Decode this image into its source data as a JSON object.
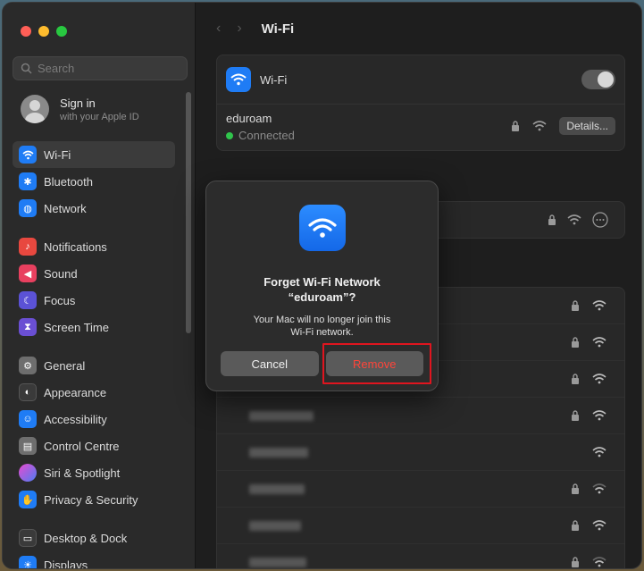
{
  "window": {
    "title": "Wi-Fi"
  },
  "sidebar": {
    "search_placeholder": "Search",
    "account": {
      "title": "Sign in",
      "subtitle": "with your Apple ID"
    },
    "items": [
      {
        "label": "Wi-Fi",
        "icon": "wifi-icon",
        "active": true
      },
      {
        "label": "Bluetooth",
        "icon": "bluetooth-icon"
      },
      {
        "label": "Network",
        "icon": "globe-icon"
      },
      {
        "label": "Notifications",
        "icon": "bell-icon"
      },
      {
        "label": "Sound",
        "icon": "speaker-icon"
      },
      {
        "label": "Focus",
        "icon": "moon-icon"
      },
      {
        "label": "Screen Time",
        "icon": "hourglass-icon"
      },
      {
        "label": "General",
        "icon": "gear-icon"
      },
      {
        "label": "Appearance",
        "icon": "appearance-icon"
      },
      {
        "label": "Accessibility",
        "icon": "accessibility-icon"
      },
      {
        "label": "Control Centre",
        "icon": "control-centre-icon"
      },
      {
        "label": "Siri & Spotlight",
        "icon": "siri-icon"
      },
      {
        "label": "Privacy & Security",
        "icon": "hand-icon"
      },
      {
        "label": "Desktop & Dock",
        "icon": "dock-icon"
      },
      {
        "label": "Displays",
        "icon": "display-icon"
      }
    ]
  },
  "main": {
    "wifi_label": "Wi-Fi",
    "current_network": {
      "name": "eduroam",
      "status": "Connected",
      "details_label": "Details..."
    }
  },
  "dialog": {
    "title_line1": "Forget Wi-Fi Network",
    "title_line2": "“eduroam”?",
    "message_line1": "Your Mac will no longer join this",
    "message_line2": "Wi-Fi network.",
    "cancel_label": "Cancel",
    "remove_label": "Remove"
  },
  "colors": {
    "accent": "#1f7cf5",
    "destructive": "#ff453a",
    "highlight_box": "#e0151f",
    "connected": "#30c54c"
  }
}
